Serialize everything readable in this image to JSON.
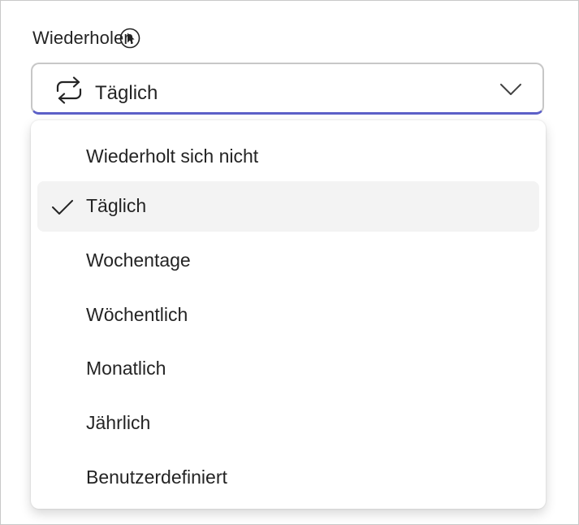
{
  "field": {
    "label": "Wiederholen",
    "selected_value": "Täglich"
  },
  "options": [
    {
      "label": "Wiederholt sich nicht",
      "selected": false
    },
    {
      "label": "Täglich",
      "selected": true
    },
    {
      "label": "Wochentage",
      "selected": false
    },
    {
      "label": "Wöchentlich",
      "selected": false
    },
    {
      "label": "Monatlich",
      "selected": false
    },
    {
      "label": "Jährlich",
      "selected": false
    },
    {
      "label": "Benutzerdefiniert",
      "selected": false
    }
  ],
  "colors": {
    "accent": "#5b5fc7",
    "text": "#242424",
    "selected_bg": "#f3f3f3",
    "border": "#c7c7c7"
  },
  "icons": {
    "field": "repeat-icon",
    "dropdown": "chevron-down-icon",
    "selected_marker": "checkmark-icon",
    "pointer": "cursor-icon"
  }
}
